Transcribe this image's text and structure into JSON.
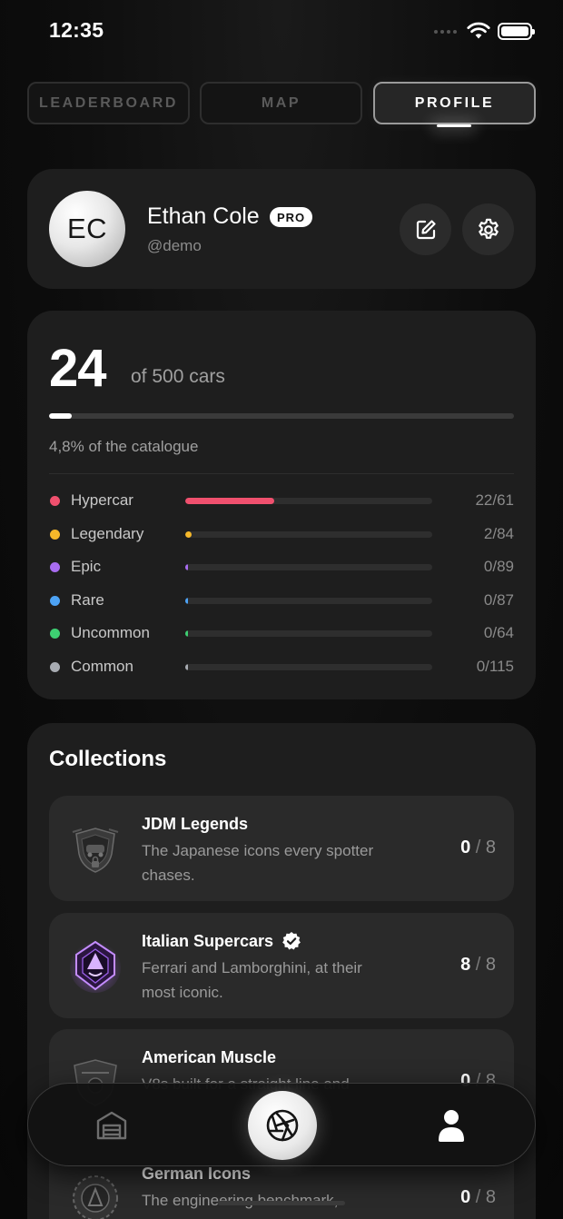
{
  "status_bar": {
    "time": "12:35"
  },
  "tabs": [
    {
      "label": "LEADERBOARD",
      "active": false
    },
    {
      "label": "MAP",
      "active": false
    },
    {
      "label": "PROFILE",
      "active": true
    }
  ],
  "profile": {
    "initials": "EC",
    "name": "Ethan Cole",
    "badge": "PRO",
    "handle": "@demo",
    "edit_icon": "edit-icon",
    "settings_icon": "gear-icon"
  },
  "stats": {
    "count": "24",
    "total_label": "of 500 cars",
    "progress_fraction": 0.048,
    "percent_label": "4,8% of the catalogue",
    "rarities": [
      {
        "label": "Hypercar",
        "count": "22/61",
        "fraction": 0.361,
        "color": "#f0506e"
      },
      {
        "label": "Legendary",
        "count": "2/84",
        "fraction": 0.024,
        "color": "#f5b82a"
      },
      {
        "label": "Epic",
        "count": "0/89",
        "fraction": 0.0,
        "color": "#a86cf0"
      },
      {
        "label": "Rare",
        "count": "0/87",
        "fraction": 0.0,
        "color": "#4da3f5"
      },
      {
        "label": "Uncommon",
        "count": "0/64",
        "fraction": 0.0,
        "color": "#3ecf72"
      },
      {
        "label": "Common",
        "count": "0/115",
        "fraction": 0.0,
        "color": "#a8acb2"
      }
    ]
  },
  "collections": {
    "title": "Collections",
    "items": [
      {
        "name": "JDM Legends",
        "description": "The Japanese icons every spotter chases.",
        "owned": "0",
        "separator": "/",
        "total": "8",
        "verified": false
      },
      {
        "name": "Italian Supercars",
        "description": "Ferrari and Lamborghini, at their most iconic.",
        "owned": "8",
        "separator": "/",
        "total": "8",
        "verified": true
      },
      {
        "name": "American Muscle",
        "description": "V8s built for a straight line and",
        "owned": "0",
        "separator": "/",
        "total": "8",
        "verified": false
      },
      {
        "name": "German Icons",
        "description": "The engineering benchmark, badge",
        "owned": "0",
        "separator": "/",
        "total": "8",
        "verified": false
      }
    ]
  },
  "bottom_nav": {
    "items": [
      "garage-icon",
      "camera-shutter-icon",
      "user-icon"
    ]
  }
}
